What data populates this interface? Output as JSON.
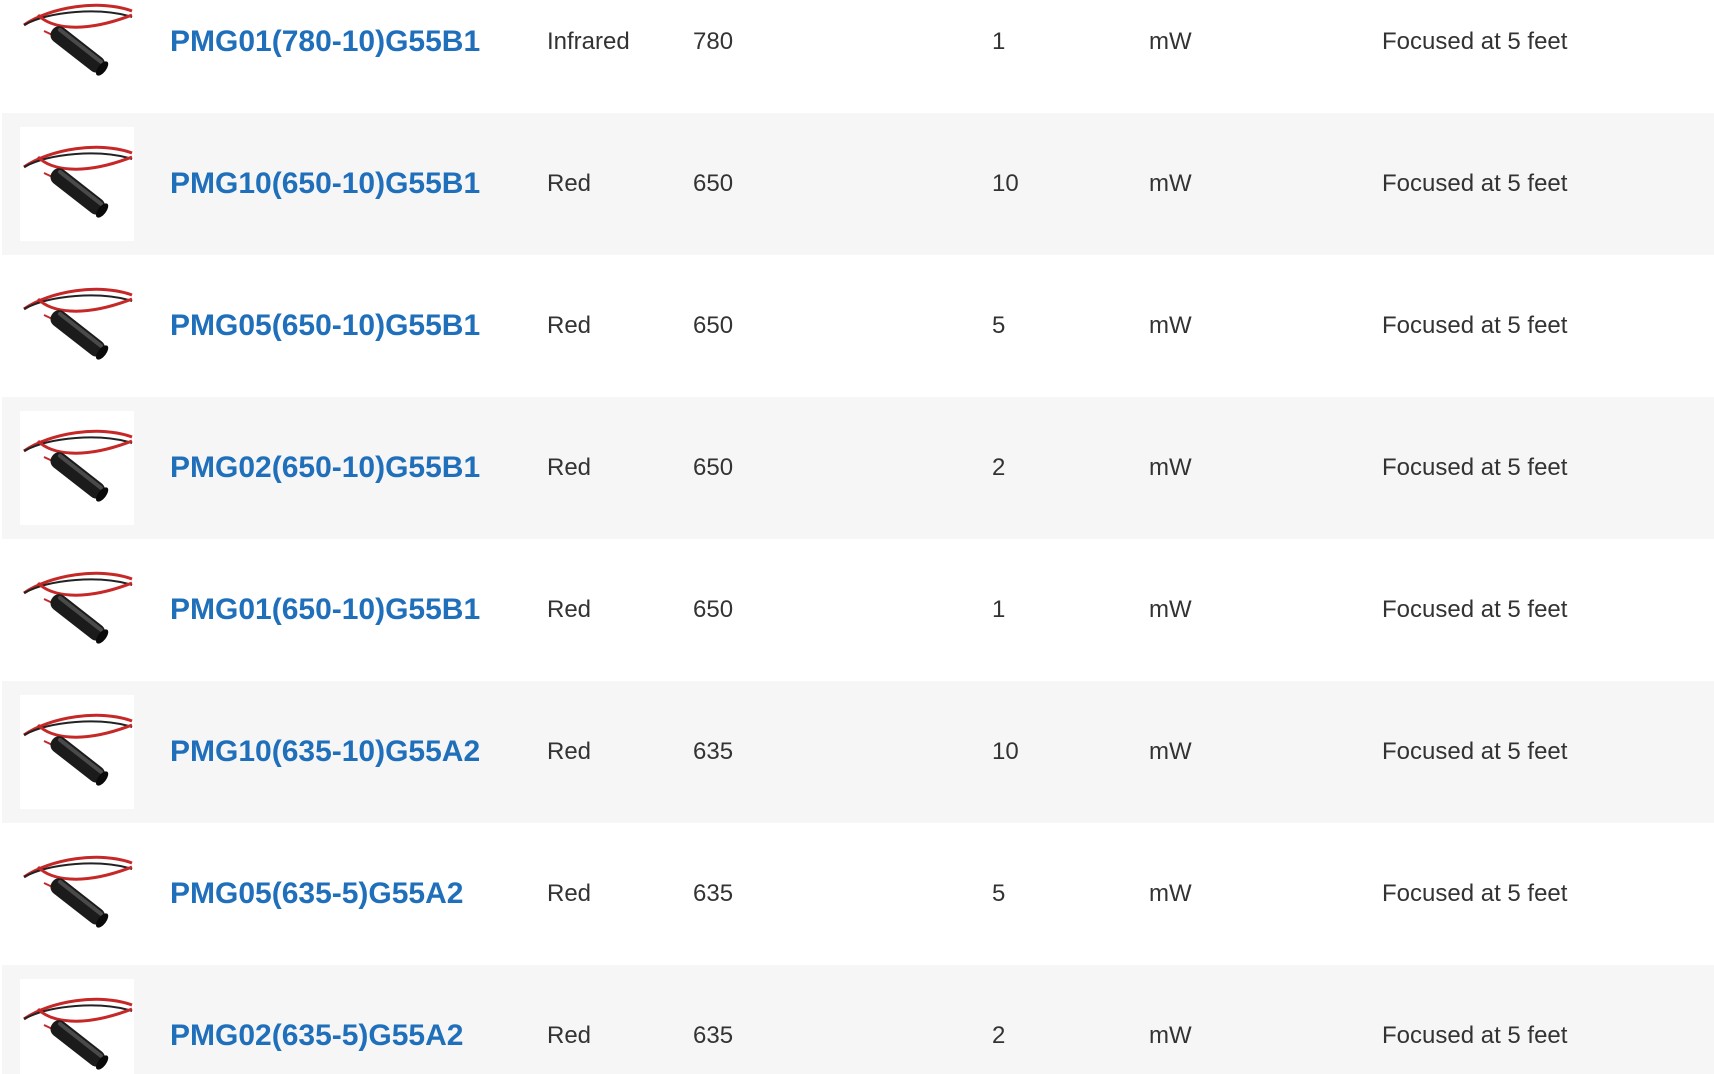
{
  "rows": [
    {
      "model": "PMG01(780-10)G55B1",
      "color": "Infrared",
      "wavelength": "780",
      "power": "1",
      "unit": "mW",
      "beam": "Focused at 5 feet"
    },
    {
      "model": "PMG10(650-10)G55B1",
      "color": "Red",
      "wavelength": "650",
      "power": "10",
      "unit": "mW",
      "beam": "Focused at 5 feet"
    },
    {
      "model": "PMG05(650-10)G55B1",
      "color": "Red",
      "wavelength": "650",
      "power": "5",
      "unit": "mW",
      "beam": "Focused at 5 feet"
    },
    {
      "model": "PMG02(650-10)G55B1",
      "color": "Red",
      "wavelength": "650",
      "power": "2",
      "unit": "mW",
      "beam": "Focused at 5 feet"
    },
    {
      "model": "PMG01(650-10)G55B1",
      "color": "Red",
      "wavelength": "650",
      "power": "1",
      "unit": "mW",
      "beam": "Focused at 5 feet"
    },
    {
      "model": "PMG10(635-10)G55A2",
      "color": "Red",
      "wavelength": "635",
      "power": "10",
      "unit": "mW",
      "beam": "Focused at 5 feet"
    },
    {
      "model": "PMG05(635-5)G55A2",
      "color": "Red",
      "wavelength": "635",
      "power": "5",
      "unit": "mW",
      "beam": "Focused at 5 feet"
    },
    {
      "model": "PMG02(635-5)G55A2",
      "color": "Red",
      "wavelength": "635",
      "power": "2",
      "unit": "mW",
      "beam": "Focused at 5 feet"
    }
  ],
  "icons": {
    "product_thumbnail": "laser-module-icon"
  },
  "colors": {
    "link": "#1f6fba",
    "text": "#333333",
    "row_alt": "#f6f6f6"
  }
}
